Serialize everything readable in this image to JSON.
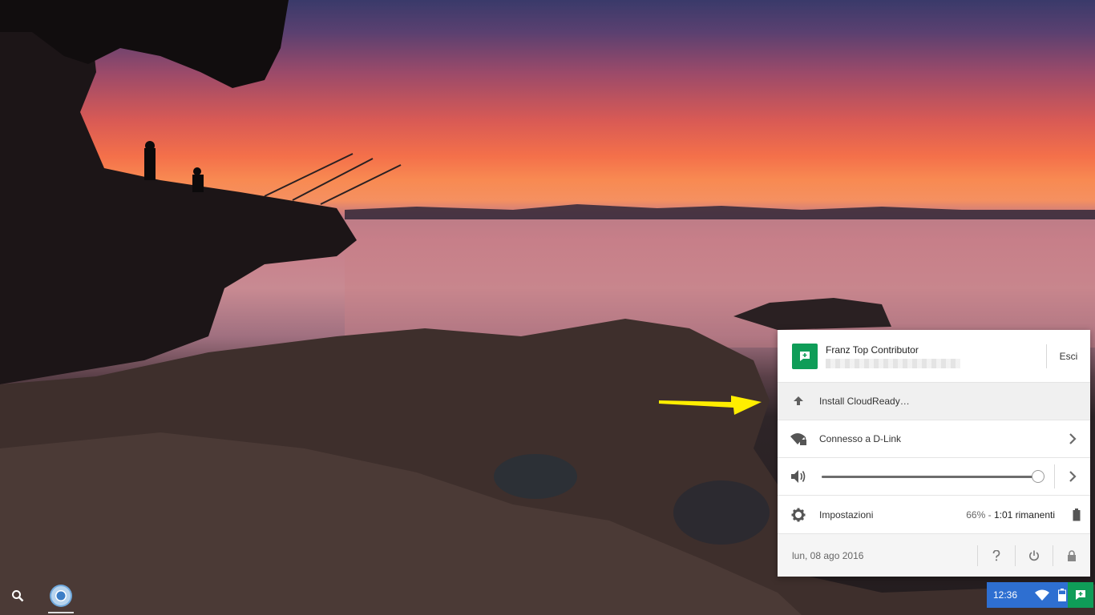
{
  "tray": {
    "user": {
      "name": "Franz Top Contributor",
      "signout_label": "Esci"
    },
    "install_label": "Install CloudReady…",
    "network_label": "Connesso a D-Link",
    "volume": {
      "level": 0.98
    },
    "settings_label": "Impostazioni",
    "battery": {
      "percent": "66%",
      "separator": " - ",
      "remaining": "1:01 rimanenti"
    },
    "date": "lun, 08 ago 2016",
    "footer_icons": [
      "help-icon",
      "power-icon",
      "lock-icon"
    ]
  },
  "shelf": {
    "time": "12:36",
    "status_icons": [
      "wifi-icon",
      "battery-icon",
      "notification-icon"
    ],
    "apps": [
      "launcher-search-icon",
      "chrome-icon"
    ]
  },
  "colors": {
    "accent_blue": "#2e6fd1",
    "notification_green": "#0f9d58",
    "arrow_yellow": "#ffee00"
  }
}
